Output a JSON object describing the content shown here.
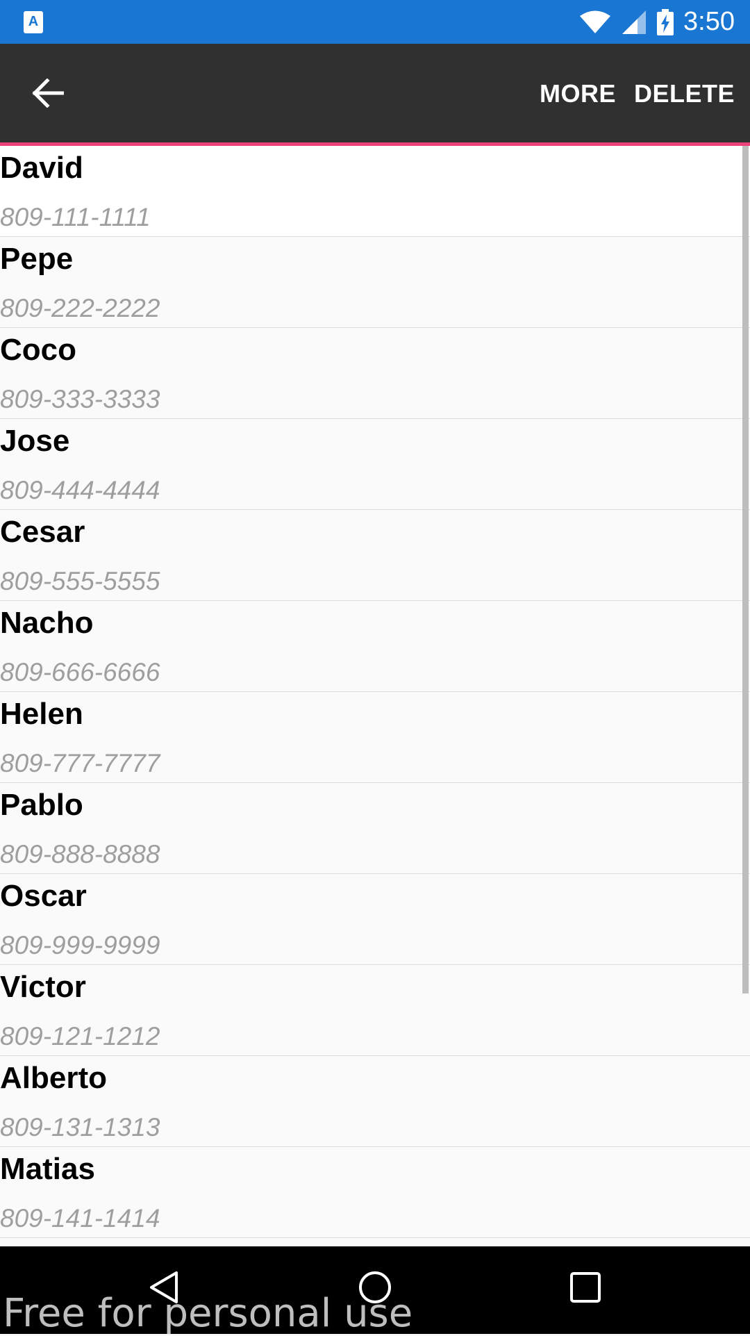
{
  "status_bar": {
    "time": "3:50",
    "app_icon_letter": "A",
    "icons": [
      "wifi-icon",
      "signal-icon",
      "battery-charging-icon"
    ]
  },
  "toolbar": {
    "back_icon": "arrow-left-icon",
    "more_label": "MORE",
    "delete_label": "DELETE",
    "accent_color": "#ec407a",
    "background_color": "#303030"
  },
  "contacts": [
    {
      "name": "David",
      "phone": "809-111-1111"
    },
    {
      "name": "Pepe",
      "phone": "809-222-2222"
    },
    {
      "name": "Coco",
      "phone": "809-333-3333"
    },
    {
      "name": "Jose",
      "phone": "809-444-4444"
    },
    {
      "name": "Cesar",
      "phone": "809-555-5555"
    },
    {
      "name": "Nacho",
      "phone": "809-666-6666"
    },
    {
      "name": "Helen",
      "phone": "809-777-7777"
    },
    {
      "name": "Pablo",
      "phone": "809-888-8888"
    },
    {
      "name": "Oscar",
      "phone": "809-999-9999"
    },
    {
      "name": "Victor",
      "phone": "809-121-1212"
    },
    {
      "name": "Alberto",
      "phone": "809-131-1313"
    },
    {
      "name": "Matias",
      "phone": "809-141-1414"
    }
  ],
  "nav_bar": {
    "icons": [
      "nav-back-icon",
      "nav-home-icon",
      "nav-recent-icon"
    ]
  },
  "watermark": "Free for personal use",
  "colors": {
    "status_bar": "#1976d2",
    "name_text": "#000000",
    "phone_text": "#9e9e9e"
  }
}
